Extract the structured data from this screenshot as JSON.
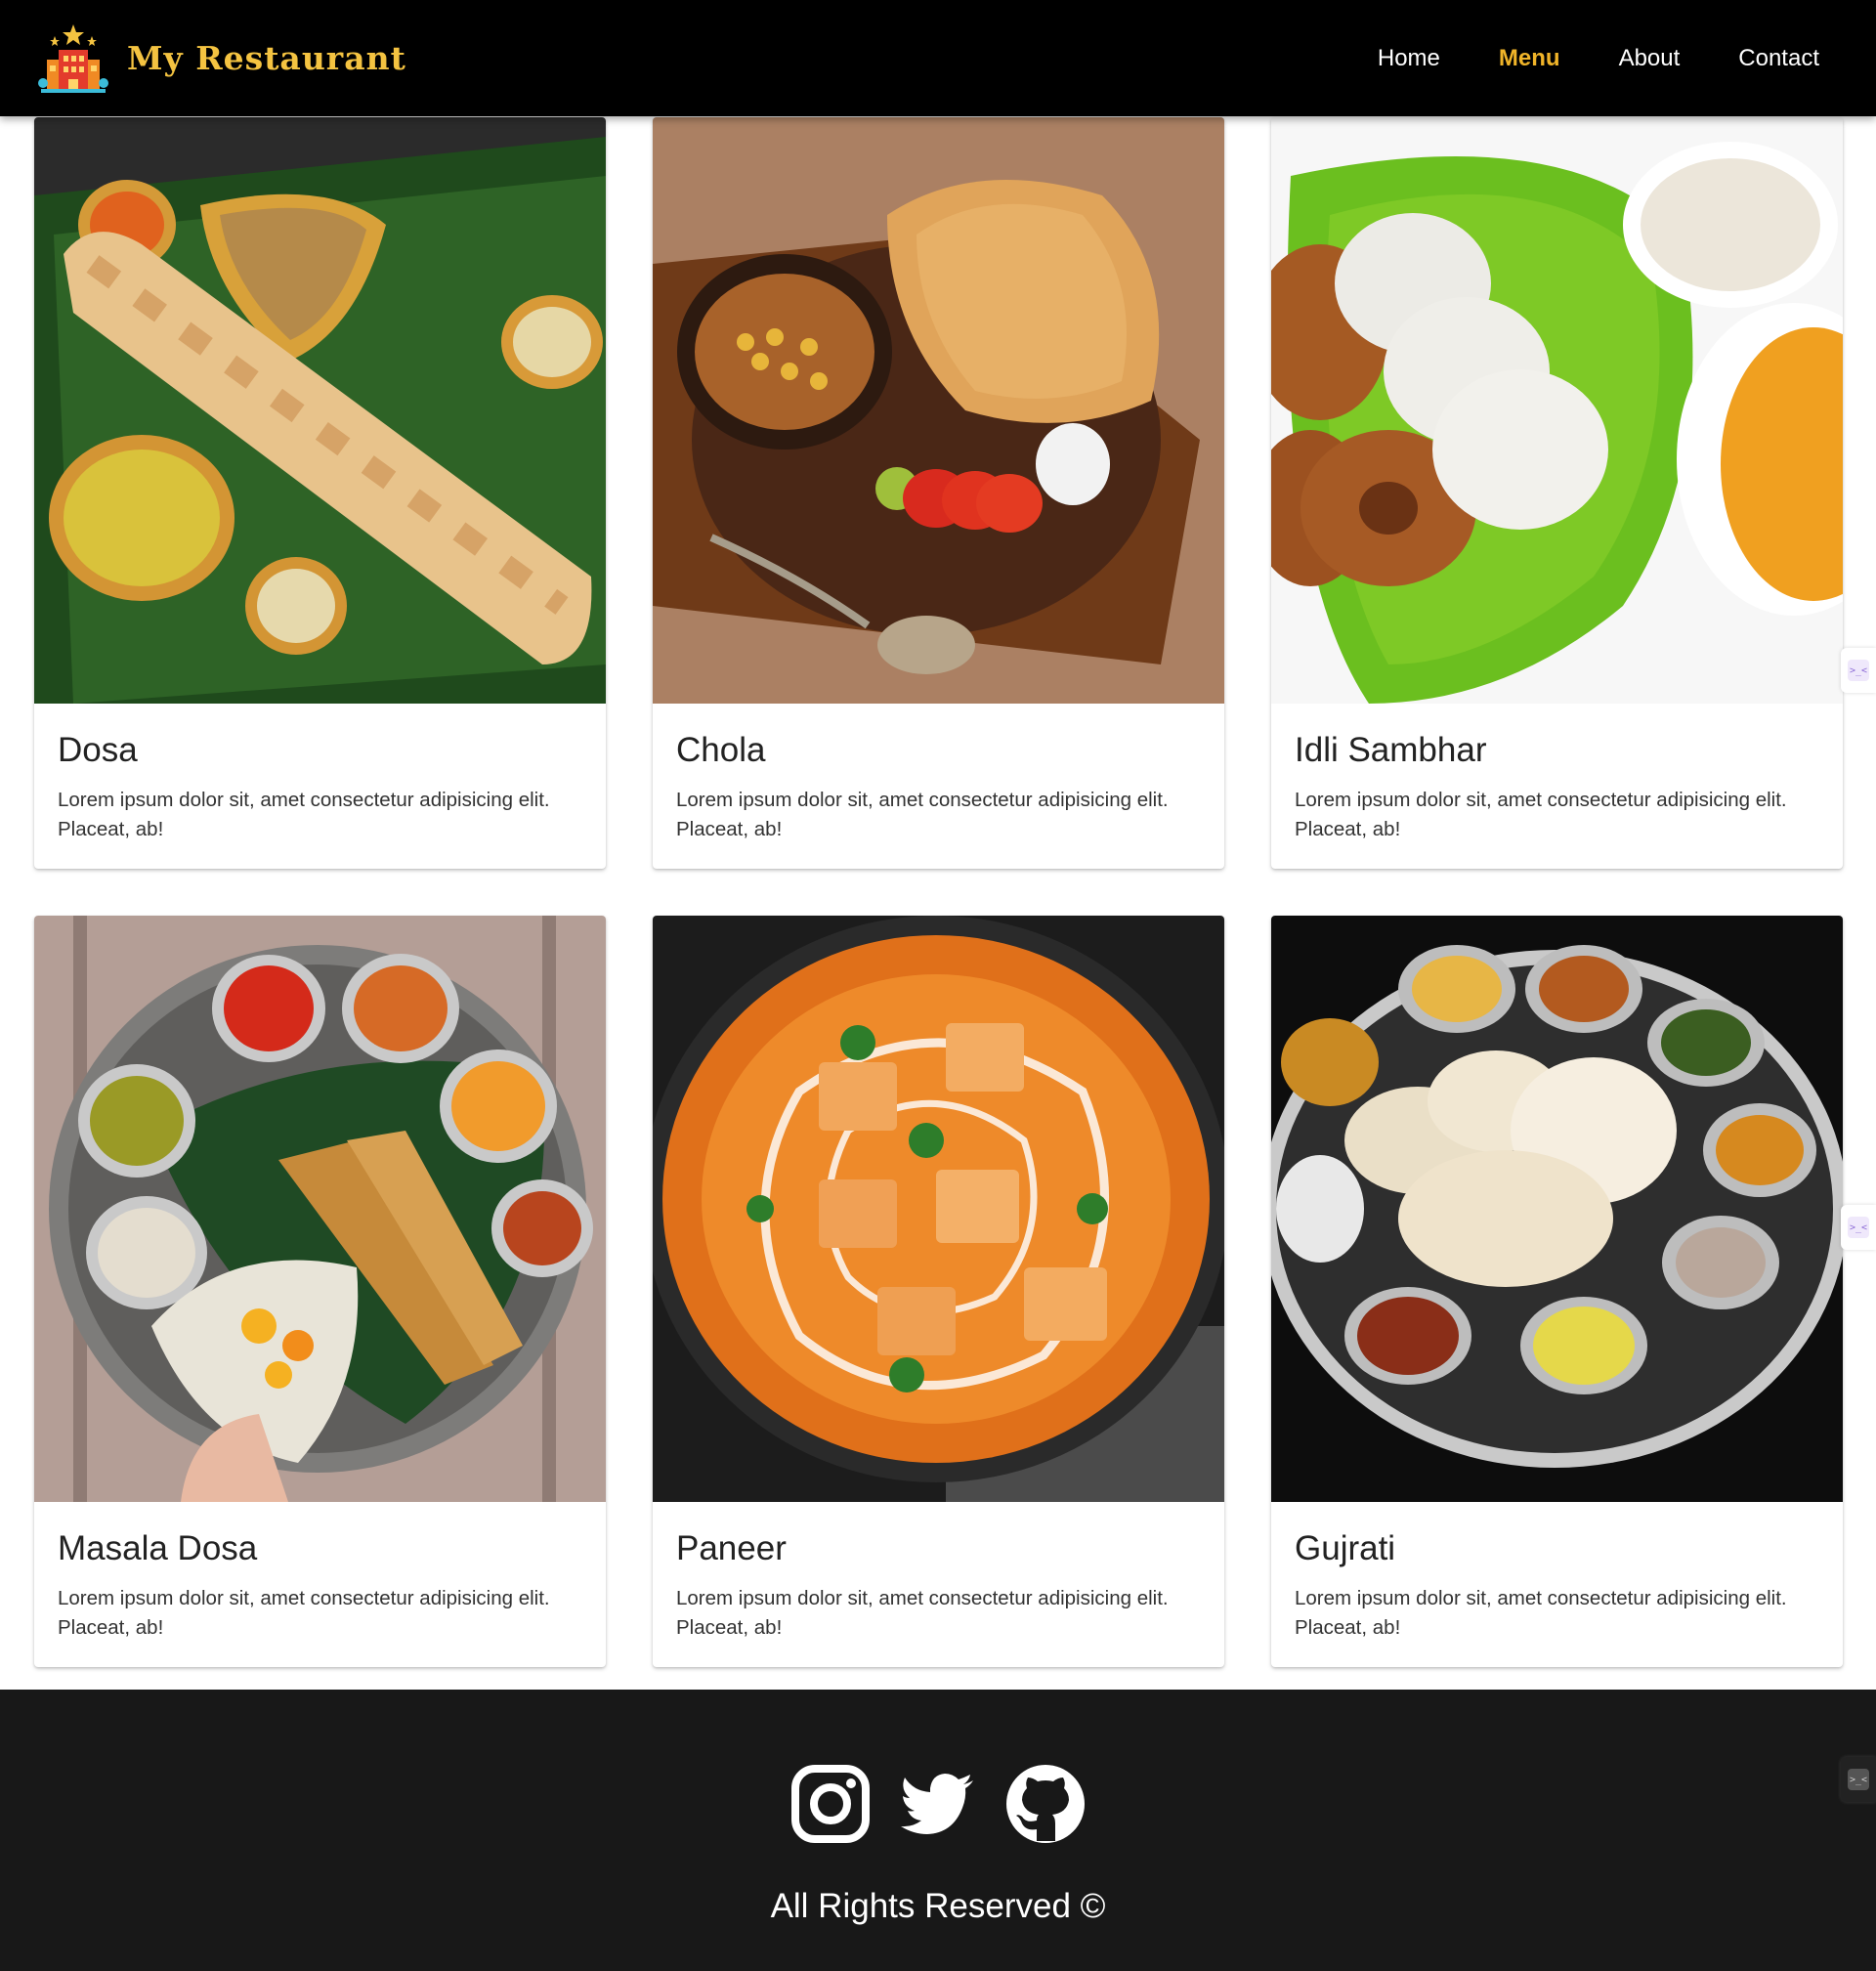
{
  "brand": {
    "name": "My Restaurant",
    "logo_icon": "restaurant-building-icon",
    "accent_color": "#f4c341"
  },
  "nav": {
    "items": [
      {
        "label": "Home",
        "active": false
      },
      {
        "label": "Menu",
        "active": true
      },
      {
        "label": "About",
        "active": false
      },
      {
        "label": "Contact",
        "active": false
      }
    ],
    "active_color": "#f0b429"
  },
  "cards": [
    {
      "title": "Dosa",
      "text": "Lorem ipsum dolor sit, amet consectetur adipisicing elit. Placeat, ab!"
    },
    {
      "title": "Chola",
      "text": "Lorem ipsum dolor sit, amet consectetur adipisicing elit. Placeat, ab!"
    },
    {
      "title": "Idli Sambhar",
      "text": "Lorem ipsum dolor sit, amet consectetur adipisicing elit. Placeat, ab!"
    },
    {
      "title": "Masala Dosa",
      "text": "Lorem ipsum dolor sit, amet consectetur adipisicing elit. Placeat, ab!"
    },
    {
      "title": "Paneer",
      "text": "Lorem ipsum dolor sit, amet consectetur adipisicing elit. Placeat, ab!"
    },
    {
      "title": "Gujrati",
      "text": "Lorem ipsum dolor sit, amet consectetur adipisicing elit. Placeat, ab!"
    }
  ],
  "footer": {
    "social": [
      "instagram-icon",
      "twitter-icon",
      "github-icon"
    ],
    "copyright": "All Rights Reserved ©",
    "background": "#181818"
  }
}
